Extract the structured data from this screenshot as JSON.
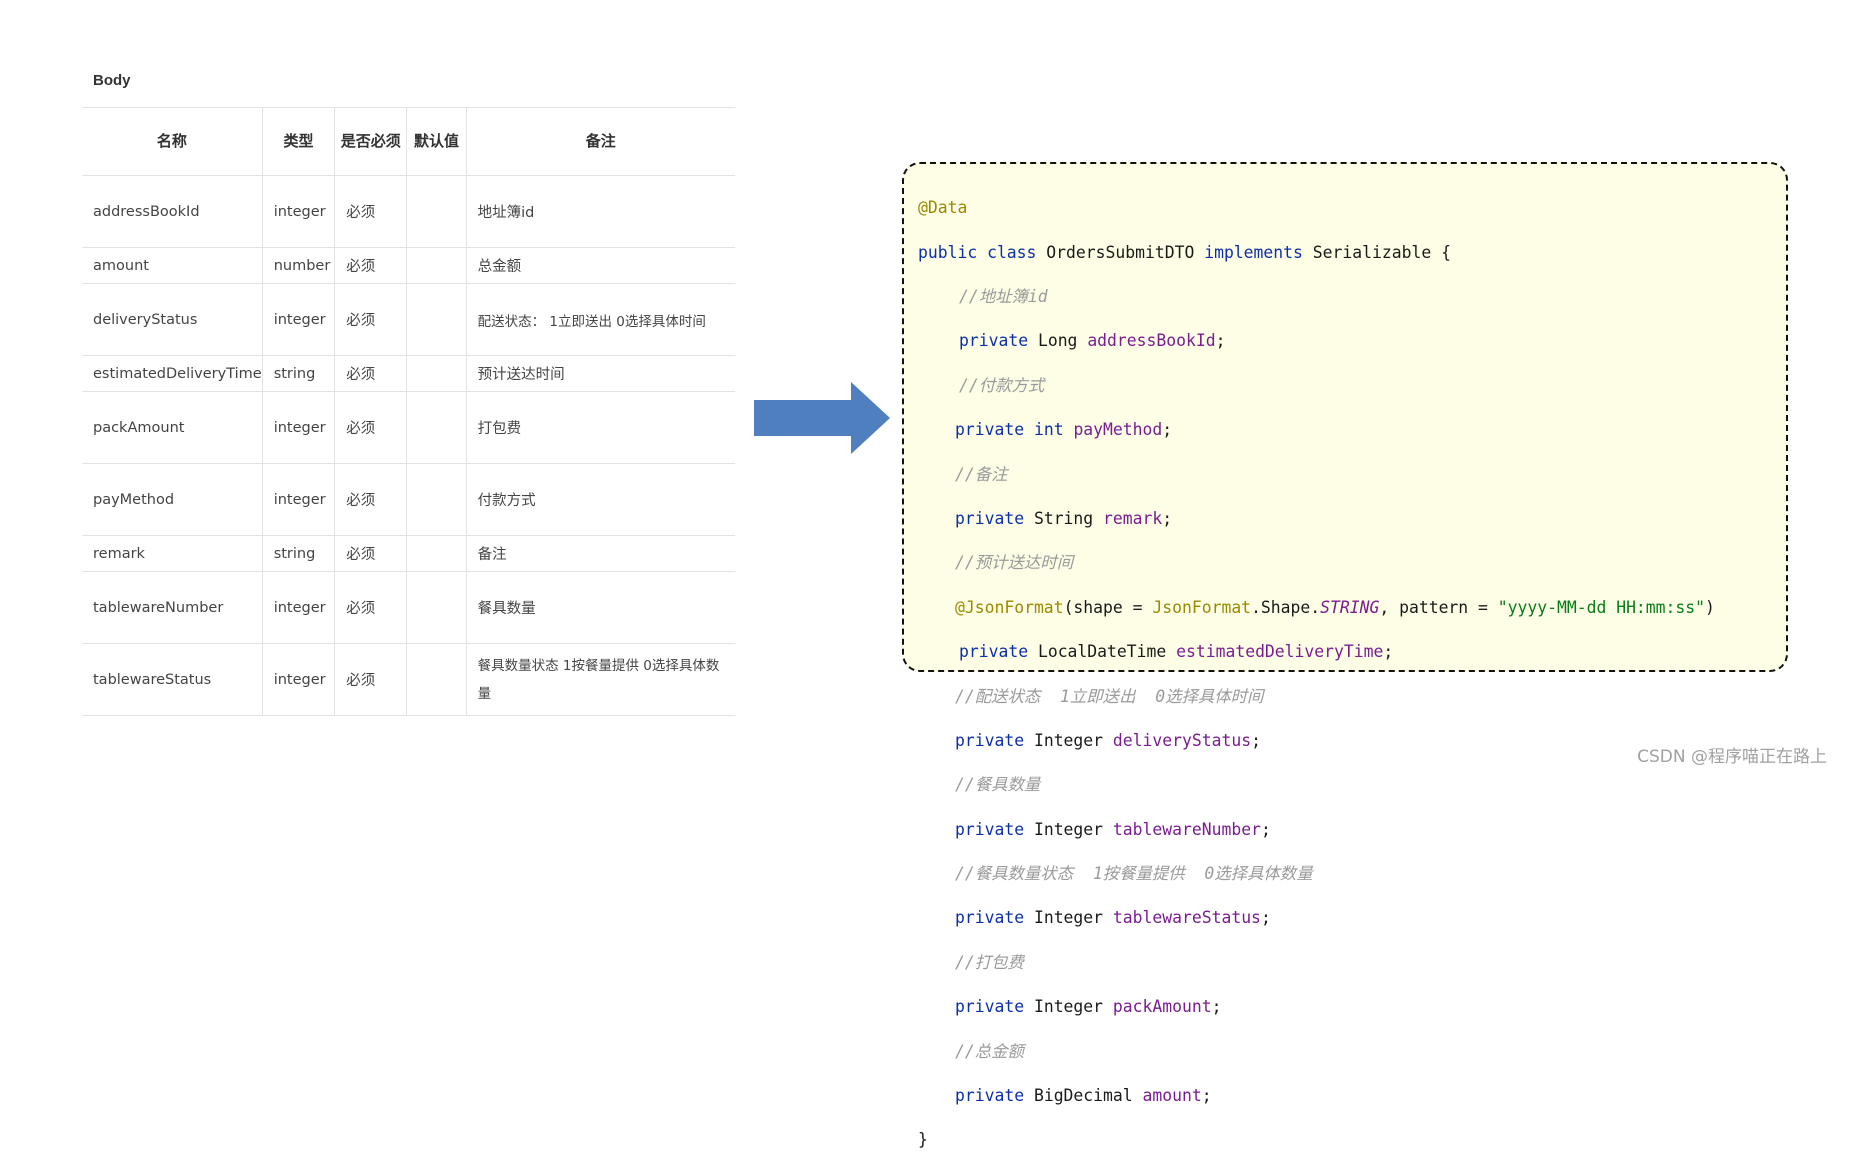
{
  "section_title": "Body",
  "table": {
    "headers": {
      "name": "名称",
      "type": "类型",
      "required": "是否必须",
      "default": "默认值",
      "remark": "备注"
    },
    "rows": [
      {
        "name": "addressBookId",
        "type": "integer",
        "required": "必须",
        "default": "",
        "remark": "地址簿id"
      },
      {
        "name": "amount",
        "type": "number",
        "required": "必须",
        "default": "",
        "remark": "总金额"
      },
      {
        "name": "deliveryStatus",
        "type": "integer",
        "required": "必须",
        "default": "",
        "remark": "配送状态： 1立即送出 0选择具体时间"
      },
      {
        "name": "estimatedDeliveryTime",
        "type": "string",
        "required": "必须",
        "default": "",
        "remark": "预计送达时间"
      },
      {
        "name": "packAmount",
        "type": "integer",
        "required": "必须",
        "default": "",
        "remark": "打包费"
      },
      {
        "name": "payMethod",
        "type": "integer",
        "required": "必须",
        "default": "",
        "remark": "付款方式"
      },
      {
        "name": "remark",
        "type": "string",
        "required": "必须",
        "default": "",
        "remark": "备注"
      },
      {
        "name": "tablewareNumber",
        "type": "integer",
        "required": "必须",
        "default": "",
        "remark": "餐具数量"
      },
      {
        "name": "tablewareStatus",
        "type": "integer",
        "required": "必须",
        "default": "",
        "remark": "餐具数量状态 1按餐量提供 0选择具体数量"
      }
    ]
  },
  "arrow_icon": "right-arrow-icon",
  "colors": {
    "arrow": "#4f7fbf",
    "code_background": "#fefee6",
    "annotation": "#9a8a00",
    "keyword": "#0d2fa8",
    "field": "#7a1d90",
    "comment": "#9a9a9a",
    "string": "#067d17"
  },
  "code": {
    "annotation_data": "@Data",
    "class_keywords": "public class",
    "class_name": "OrdersSubmitDTO",
    "implements_keyword": "implements",
    "interface_name": "Serializable",
    "open_brace": "{",
    "close_brace": "}",
    "private_keyword": "private",
    "int_keyword": "int",
    "comments": {
      "address_book": "//地址簿id",
      "pay_method": "//付款方式",
      "remark": "//备注",
      "estimated_time": "//预计送达时间",
      "delivery_status": "//配送状态  1立即送出  0选择具体时间",
      "tableware_number": "//餐具数量",
      "tableware_status": "//餐具数量状态  1按餐量提供  0选择具体数量",
      "pack_amount": "//打包费",
      "amount": "//总金额"
    },
    "types": {
      "long": "Long",
      "string": "String",
      "local_date_time": "LocalDateTime",
      "integer": "Integer",
      "big_decimal": "BigDecimal"
    },
    "fields": {
      "address_book_id": "addressBookId",
      "pay_method": "payMethod",
      "remark": "remark",
      "estimated_delivery_time": "estimatedDeliveryTime",
      "delivery_status": "deliveryStatus",
      "tableware_number": "tablewareNumber",
      "tableware_status": "tablewareStatus",
      "pack_amount": "packAmount",
      "amount": "amount"
    },
    "json_format": {
      "annotation": "@JsonFormat",
      "open": "(shape = ",
      "class_ref": "JsonFormat",
      "shape_ref": ".Shape.",
      "constant": "STRING",
      "pattern_part": ", pattern = ",
      "pattern_value": "\"yyyy-MM-dd HH:mm:ss\"",
      "close": ")"
    },
    "semicolon": ";"
  },
  "watermark": "CSDN @程序喵正在路上"
}
